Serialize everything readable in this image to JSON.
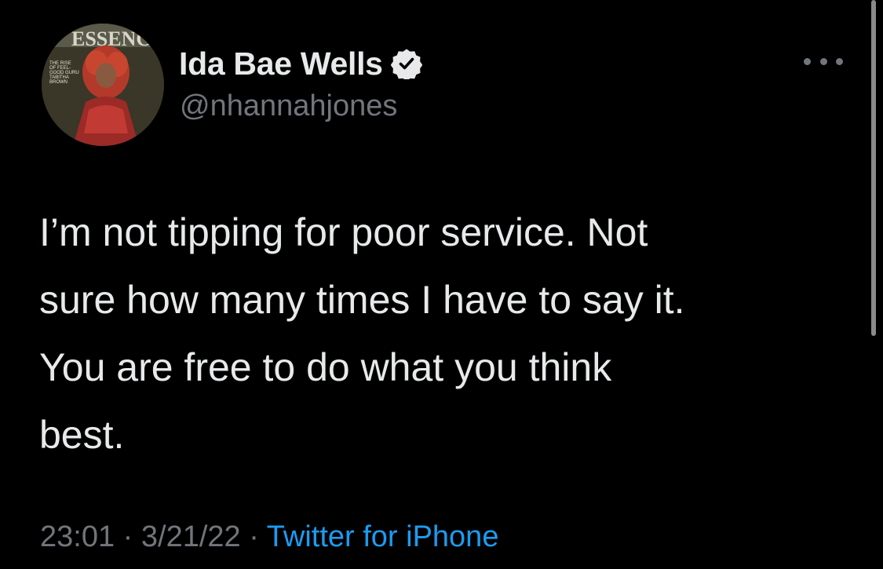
{
  "author": {
    "display_name": "Ida Bae Wells",
    "handle": "@nhannahjones",
    "verified_icon": "verified-badge-icon",
    "avatar": {
      "magazine_title": "ESSENCE",
      "cover_text_lines": [
        "THE RISE",
        "OF FEEL-",
        "GOOD GURU",
        "TABITHA",
        "BROWN"
      ]
    }
  },
  "tweet": {
    "text": "I’m not tipping for poor service. Not\nsure how many times I have to say it.\nYou are free to do what you think\nbest.",
    "time": "23:01",
    "date": "3/21/22",
    "separator": "·",
    "source": "Twitter for iPhone"
  },
  "icons": {
    "more": "more-options-icon"
  },
  "colors": {
    "background": "#000000",
    "primary_text": "#e7e9ea",
    "secondary_text": "#71767b",
    "accent": "#1d9bf0"
  }
}
